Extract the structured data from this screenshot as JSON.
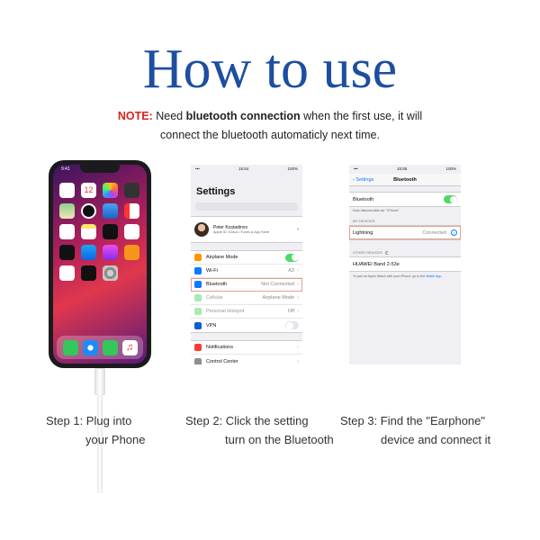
{
  "title": "How to use",
  "note": {
    "label": "NOTE:",
    "pre": "Need",
    "bold": "bluetooth connection",
    "post": "when the first use, it will",
    "line2": "connect the bluetooth automaticly next time."
  },
  "phone": {
    "time": "9:41",
    "apps": [
      "Photos",
      "Calendar",
      "Photos",
      "Camera",
      "Maps",
      "Clock",
      "Weather",
      "News",
      "Home",
      "Notes",
      "Stocks",
      "Reminders",
      "TV",
      "App Store",
      "iTunes",
      "Books",
      "Health",
      "Wallet",
      "Settings"
    ]
  },
  "settings_screen": {
    "status_time": "15:54",
    "status_battery": "100%",
    "title": "Settings",
    "profile_name": "Peter Kostadinov",
    "profile_sub": "Apple ID, iCloud, iTunes & App Store",
    "rows_group1": [
      {
        "label": "Airplane Mode",
        "value": "",
        "toggle": "on",
        "color": "#ff9500"
      },
      {
        "label": "Wi-Fi",
        "value": "A3",
        "toggle": "",
        "color": "#0a7aff"
      },
      {
        "label": "Bluetooth",
        "value": "Not Connected",
        "toggle": "",
        "color": "#0a7aff"
      },
      {
        "label": "Cellular",
        "value": "Airplane Mode",
        "toggle": "",
        "color": "#4cd964"
      },
      {
        "label": "Personal Hotspot",
        "value": "Off",
        "toggle": "",
        "color": "#4cd964"
      },
      {
        "label": "VPN",
        "value": "",
        "toggle": "off",
        "color": "#0a5fd6"
      }
    ],
    "rows_group2": [
      {
        "label": "Notifications",
        "color": "#ff3b30"
      },
      {
        "label": "Control Center",
        "color": "#8e8e93"
      }
    ]
  },
  "bluetooth_screen": {
    "status_time": "15:55",
    "status_battery": "100%",
    "back": "Settings",
    "title": "Bluetooth",
    "toggle_label": "Bluetooth",
    "discoverable": "Now discoverable as “ iPhone”",
    "my_devices_header": "MY DEVICES",
    "device_name": "Lightning",
    "device_status": "Connected",
    "other_devices_header": "OTHER DEVICES",
    "other_device": "HUAWEI Band 2-53e",
    "footer": "To pair an Apple Watch with your iPhone, go to the",
    "footer_link": "Watch app."
  },
  "steps": [
    {
      "line1": "Step 1: Plug into",
      "line2": "your Phone"
    },
    {
      "line1": "Step 2: Click the setting",
      "line2": "turn on the Bluetooth"
    },
    {
      "line1": "Step 3: Find the \"Earphone\"",
      "line2": "device and connect it"
    }
  ],
  "colors": {
    "title": "#1d4ea0",
    "note_label": "#d9241c",
    "ios_blue": "#0a7aff",
    "ios_green": "#4cd964"
  }
}
